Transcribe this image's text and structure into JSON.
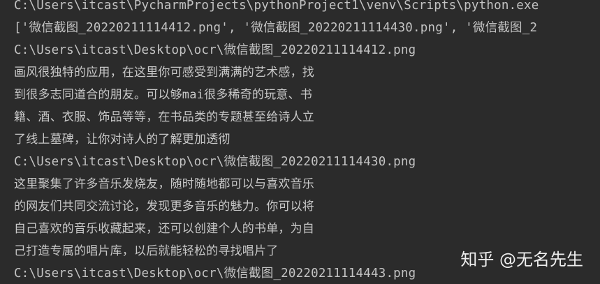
{
  "console": {
    "lines": [
      {
        "text": "C:\\Users\\itcast\\PycharmProjects\\pythonProject1\\venv\\Scripts\\python.exe",
        "kind": "path"
      },
      {
        "text": "['微信截图_20220211114412.png', '微信截图_20220211114430.png', '微信截图_2",
        "kind": "path"
      },
      {
        "text": "C:\\Users\\itcast\\Desktop\\ocr\\微信截图_20220211114412.png",
        "kind": "path"
      },
      {
        "text": "画风很独特的应用，在这里你可感受到满满的艺术感，找",
        "kind": "text"
      },
      {
        "text": "到很多志同道合的朋友。可以够mai很多稀奇的玩意、书",
        "kind": "text"
      },
      {
        "text": "籍、酒、衣服、饰品等等，在书品类的专题甚至给诗人立",
        "kind": "text"
      },
      {
        "text": "了线上墓碑，让你对诗人的了解更加透彻",
        "kind": "text"
      },
      {
        "text": "C:\\Users\\itcast\\Desktop\\ocr\\微信截图_20220211114430.png",
        "kind": "path"
      },
      {
        "text": "这里聚集了许多音乐发烧友，随时随地都可以与喜欢音乐",
        "kind": "text"
      },
      {
        "text": "的网友们共同交流讨论，发现更多音乐的魅力。你可以将",
        "kind": "text"
      },
      {
        "text": "自己喜欢的音乐收藏起来，还可以创建个人的书单，为自",
        "kind": "text"
      },
      {
        "text": "己打造专属的唱片库，以后就能轻松的寻找唱片了",
        "kind": "text"
      },
      {
        "text": "C:\\Users\\itcast\\Desktop\\ocr\\微信截图_20220211114443.png",
        "kind": "path"
      }
    ]
  },
  "watermark": {
    "text": "知乎 @无名先生"
  },
  "colors": {
    "background": "#2b2b2b",
    "text": "#bbbbbb"
  }
}
